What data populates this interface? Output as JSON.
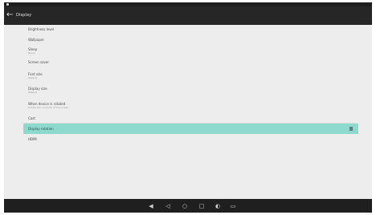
{
  "app_bar": {
    "title": "Display"
  },
  "settings": [
    {
      "title": "Brightness level",
      "subtitle": ""
    },
    {
      "title": "Wallpaper",
      "subtitle": ""
    },
    {
      "title": "Sleep",
      "subtitle": "Never"
    },
    {
      "title": "Screen saver",
      "subtitle": ""
    },
    {
      "title": "Font size",
      "subtitle": "Default"
    },
    {
      "title": "Display size",
      "subtitle": "Default"
    },
    {
      "title": "When device is rotated",
      "subtitle": "Rotate the contents of the screen"
    },
    {
      "title": "Cast",
      "subtitle": ""
    },
    {
      "title": "Display rotation",
      "subtitle": "",
      "selected": true
    },
    {
      "title": "HDMI",
      "subtitle": ""
    }
  ],
  "colors": {
    "selected_row": "#8ed9cd",
    "app_bar": "#262626",
    "background": "#ededed"
  },
  "nav_icons": [
    "volume-down-icon",
    "back-icon",
    "home-icon",
    "recents-icon",
    "volume-up-icon",
    "screenshot-icon"
  ]
}
